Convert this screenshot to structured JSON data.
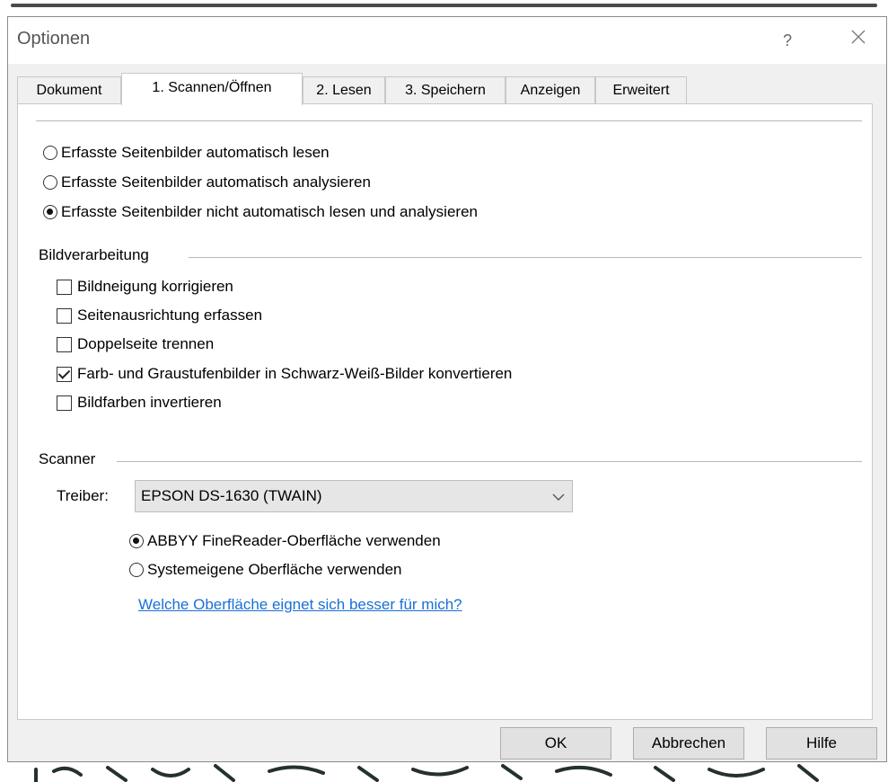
{
  "window": {
    "title": "Optionen",
    "help_glyph": "?"
  },
  "tabs": [
    {
      "label": "Dokument",
      "active": false
    },
    {
      "label": "1. Scannen/Öffnen",
      "active": true
    },
    {
      "label": "2. Lesen",
      "active": false
    },
    {
      "label": "3. Speichern",
      "active": false
    },
    {
      "label": "Anzeigen",
      "active": false
    },
    {
      "label": "Erweitert",
      "active": false
    }
  ],
  "auto_options": [
    {
      "label": "Erfasste Seitenbilder automatisch lesen",
      "checked": false
    },
    {
      "label": "Erfasste Seitenbilder automatisch analysieren",
      "checked": false
    },
    {
      "label": "Erfasste Seitenbilder nicht automatisch lesen und analysieren",
      "checked": true
    }
  ],
  "image_processing": {
    "title": "Bildverarbeitung",
    "options": [
      {
        "label": "Bildneigung korrigieren",
        "checked": false
      },
      {
        "label": "Seitenausrichtung erfassen",
        "checked": false
      },
      {
        "label": "Doppelseite trennen",
        "checked": false
      },
      {
        "label": "Farb- und Graustufenbilder in Schwarz-Weiß-Bilder konvertieren",
        "checked": true
      },
      {
        "label": "Bildfarben invertieren",
        "checked": false
      }
    ]
  },
  "scanner": {
    "title": "Scanner",
    "driver_label": "Treiber:",
    "driver_value": "EPSON DS-1630 (TWAIN)",
    "interface_options": [
      {
        "label": "ABBYY FineReader-Oberfläche verwenden",
        "checked": true
      },
      {
        "label": "Systemeigene Oberfläche verwenden",
        "checked": false
      }
    ],
    "help_link": "Welche Oberfläche eignet sich besser für mich?"
  },
  "buttons": {
    "ok": "OK",
    "cancel": "Abbrechen",
    "help": "Hilfe"
  },
  "colors": {
    "link": "#1a6fd6",
    "dialog_bg": "#f0f0f0",
    "panel_bg": "#ffffff"
  }
}
